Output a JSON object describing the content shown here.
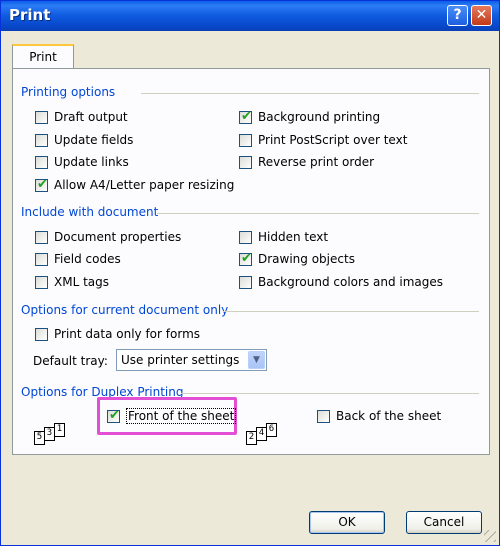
{
  "window": {
    "title": "Print",
    "help_glyph": "?",
    "close_glyph": "✕"
  },
  "tabs": [
    {
      "label": "Print"
    }
  ],
  "groups": {
    "printing_options": {
      "title": "Printing options",
      "items": [
        {
          "label": "Draft output",
          "checked": false
        },
        {
          "label": "Update fields",
          "checked": false
        },
        {
          "label": "Update links",
          "checked": false
        },
        {
          "label": "Allow A4/Letter paper resizing",
          "checked": true
        },
        {
          "label": "Background printing",
          "checked": true
        },
        {
          "label": "Print PostScript over text",
          "checked": false
        },
        {
          "label": "Reverse print order",
          "checked": false
        }
      ]
    },
    "include": {
      "title": "Include with document",
      "items": [
        {
          "label": "Document properties",
          "checked": false
        },
        {
          "label": "Field codes",
          "checked": false
        },
        {
          "label": "XML tags",
          "checked": false
        },
        {
          "label": "Hidden text",
          "checked": false
        },
        {
          "label": "Drawing objects",
          "checked": true
        },
        {
          "label": "Background colors and images",
          "checked": false
        }
      ]
    },
    "current_doc": {
      "title": "Options for current document only",
      "print_data_only": {
        "label": "Print data only for forms",
        "checked": false
      },
      "default_tray_label": "Default tray:",
      "default_tray_value": "Use printer settings"
    },
    "duplex": {
      "title": "Options for Duplex Printing",
      "front": {
        "label": "Front of the sheet",
        "checked": true
      },
      "back": {
        "label": "Back of the sheet",
        "checked": false
      },
      "front_pages": [
        "5",
        "3",
        "1"
      ],
      "back_pages": [
        "2",
        "4",
        "6"
      ]
    }
  },
  "buttons": {
    "ok": "OK",
    "cancel": "Cancel"
  },
  "colors": {
    "highlight": "#e34fd4",
    "group_title": "#0046d5",
    "title_bar": "#0a5ee6"
  },
  "icons": {
    "check": "check-icon",
    "dropdown": "chevron-down-icon"
  }
}
